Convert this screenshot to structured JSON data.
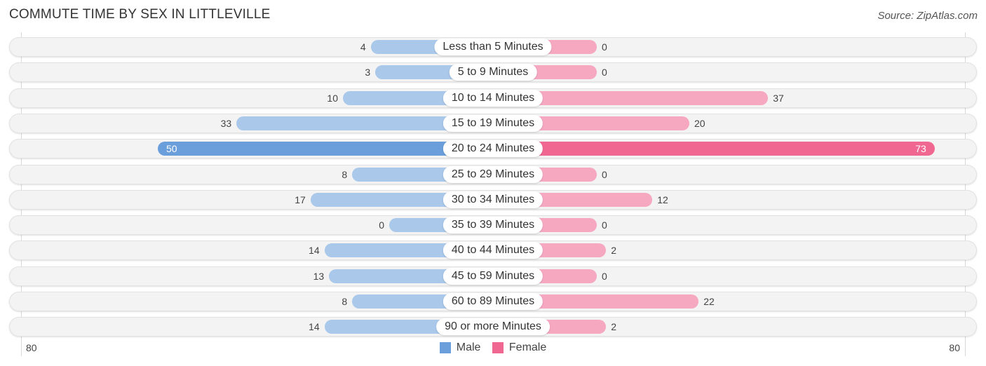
{
  "title": "COMMUTE TIME BY SEX IN LITTLEVILLE",
  "source": "Source: ZipAtlas.com",
  "colors": {
    "male": "#6a9fdb",
    "male_light": "#a9c8ea",
    "female": "#f06892",
    "female_light": "#f6a8c1"
  },
  "chart_data": {
    "type": "bar",
    "orientation": "horizontal-diverging",
    "title": "COMMUTE TIME BY SEX IN LITTLEVILLE",
    "categories": [
      "Less than 5 Minutes",
      "5 to 9 Minutes",
      "10 to 14 Minutes",
      "15 to 19 Minutes",
      "20 to 24 Minutes",
      "25 to 29 Minutes",
      "30 to 34 Minutes",
      "35 to 39 Minutes",
      "40 to 44 Minutes",
      "45 to 59 Minutes",
      "60 to 89 Minutes",
      "90 or more Minutes"
    ],
    "series": [
      {
        "name": "Male",
        "values": [
          4,
          3,
          10,
          33,
          50,
          8,
          17,
          0,
          14,
          13,
          8,
          14
        ]
      },
      {
        "name": "Female",
        "values": [
          0,
          0,
          37,
          20,
          73,
          0,
          12,
          0,
          2,
          0,
          22,
          2
        ]
      }
    ],
    "axis": {
      "left_label": "80",
      "right_label": "80",
      "range": [
        80,
        80
      ]
    },
    "legend": {
      "position": "bottom-center",
      "entries": [
        "Male",
        "Female"
      ]
    }
  }
}
